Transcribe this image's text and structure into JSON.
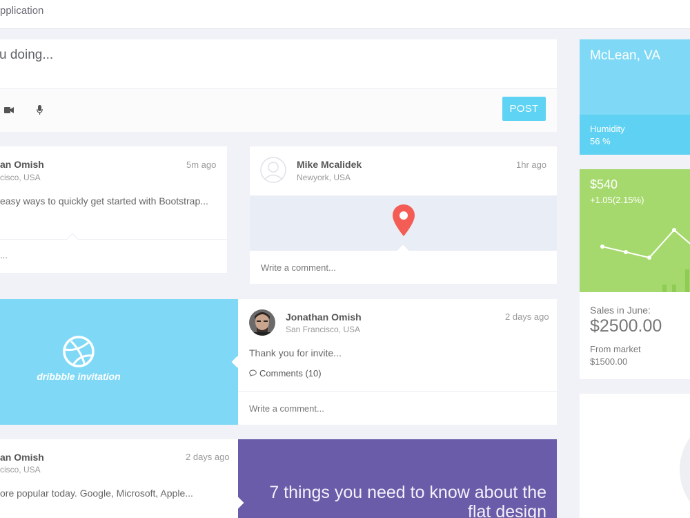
{
  "app": {
    "title": "pplication"
  },
  "composer": {
    "placeholder": "u doing...",
    "post_label": "POST",
    "tools": [
      "video-camera-icon",
      "microphone-icon"
    ]
  },
  "feed": {
    "post1": {
      "name": "an Omish",
      "location": "cisco, USA",
      "time": "5m ago",
      "text": "easy ways to quickly get started with Bootstrap...",
      "footer": "..."
    },
    "post2": {
      "name": "Mike Mcalidek",
      "location": "Newyork, USA",
      "time": "1hr ago",
      "comment_placeholder": "Write a comment..."
    },
    "post3": {
      "media_label": "dribbble invitation",
      "name": "Jonathan Omish",
      "location": "San Francisco, USA",
      "time": "2 days ago",
      "text": "Thank you for invite...",
      "comments": "Comments (10)",
      "comment_placeholder": "Write a comment..."
    },
    "post4": {
      "name": "an Omish",
      "location": "cisco, USA",
      "time": "2 days ago",
      "text": "ore popular today. Google, Microsoft, Apple...",
      "headline_line1": "7 things you need to know about the",
      "headline_line2": "flat design"
    }
  },
  "weather": {
    "city": "McLean, VA",
    "humidity_label": "Humidity",
    "humidity_value": "56 %"
  },
  "stock": {
    "price": "$540",
    "change": "+1.05(2.15%)",
    "sales_label": "Sales in June:",
    "sales_value": "$2500.00",
    "market_label": "From market",
    "market_value": "$1500.00",
    "sparkline": [
      2,
      1,
      0,
      5,
      2
    ],
    "bars": [
      1,
      1,
      3
    ]
  },
  "colors": {
    "accent_blue": "#5fd3f3",
    "light_blue": "#7fd9f6",
    "green": "#a6d96d",
    "purple": "#6a5ca8",
    "pin_red": "#f45d55"
  }
}
